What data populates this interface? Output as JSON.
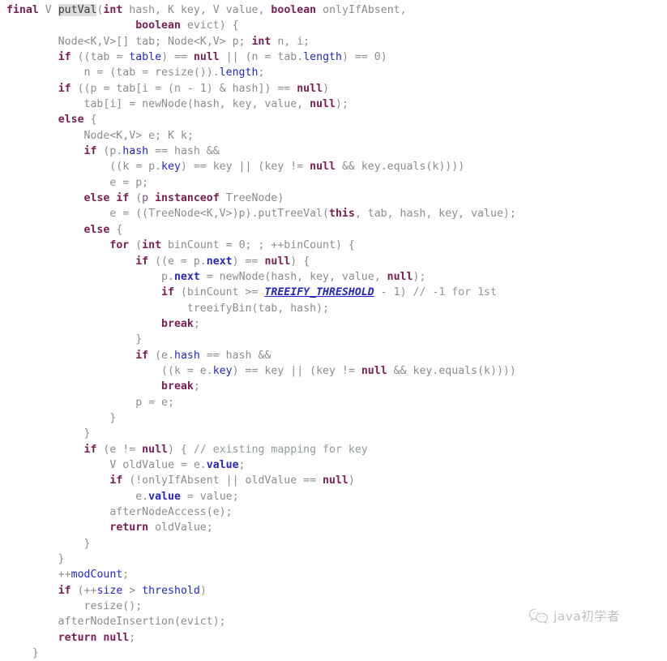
{
  "document": {
    "language": "java",
    "method_name": "putVal",
    "highlighted_identifier": "putVal",
    "background_color": "#ffffff",
    "line_count": 41
  },
  "theme": {
    "plain_text": "#8c8c8c",
    "keyword": "#7a1f54",
    "field": "#2626c4",
    "local_variable": "#7a5577",
    "constant": "#2626c4",
    "comment": "#8d9b95",
    "highlight_background": "#dcdcdc"
  },
  "watermark": {
    "icon": "wechat-chat-bubble-icon",
    "text": "java初学者"
  },
  "code": {
    "lines": [
      [
        [
          "final ",
          "kw"
        ],
        [
          "V ",
          "type"
        ],
        [
          "putVal",
          "hl"
        ],
        [
          "(",
          "plain"
        ],
        [
          "int ",
          "kw"
        ],
        [
          "hash",
          "plain"
        ],
        [
          ", ",
          "plain"
        ],
        [
          "K ",
          "type"
        ],
        [
          "key",
          "plain"
        ],
        [
          ", ",
          "plain"
        ],
        [
          "V ",
          "type"
        ],
        [
          "value",
          "plain"
        ],
        [
          ", ",
          "plain"
        ],
        [
          "boolean ",
          "kw"
        ],
        [
          "onlyIfAbsent",
          "plain"
        ],
        [
          ",",
          "plain"
        ]
      ],
      [
        [
          "                    ",
          "plain"
        ],
        [
          "boolean ",
          "kw"
        ],
        [
          "evict",
          "plain"
        ],
        [
          ") {",
          "plain"
        ]
      ],
      [
        [
          "        Node<K,V>[] tab; Node<K,V> p; ",
          "plain"
        ],
        [
          "int ",
          "kw"
        ],
        [
          "n, i;",
          "plain"
        ]
      ],
      [
        [
          "        ",
          "plain"
        ],
        [
          "if ",
          "kw"
        ],
        [
          "((tab = ",
          "plain"
        ],
        [
          "table",
          "field"
        ],
        [
          ") == ",
          "plain"
        ],
        [
          "null ",
          "kw"
        ],
        [
          "|| (n = tab.",
          "plain"
        ],
        [
          "length",
          "field"
        ],
        [
          ") == ",
          "plain"
        ],
        [
          "0",
          "num"
        ],
        [
          ")",
          "plain"
        ]
      ],
      [
        [
          "            n = (tab = resize()).",
          "plain"
        ],
        [
          "length",
          "field"
        ],
        [
          ";",
          "plain"
        ]
      ],
      [
        [
          "        ",
          "plain"
        ],
        [
          "if ",
          "kw"
        ],
        [
          "((p = tab[i = (n - ",
          "plain"
        ],
        [
          "1",
          "num"
        ],
        [
          ") & hash]) == ",
          "plain"
        ],
        [
          "null",
          "kw"
        ],
        [
          ")",
          "plain"
        ]
      ],
      [
        [
          "            tab[i] = newNode(hash, key, value, ",
          "plain"
        ],
        [
          "null",
          "kw"
        ],
        [
          ");",
          "plain"
        ]
      ],
      [
        [
          "        ",
          "plain"
        ],
        [
          "else ",
          "kw"
        ],
        [
          "{",
          "plain"
        ]
      ],
      [
        [
          "            Node<K,V> e; K k;",
          "plain"
        ]
      ],
      [
        [
          "            ",
          "plain"
        ],
        [
          "if ",
          "kw"
        ],
        [
          "(p.",
          "plain"
        ],
        [
          "hash ",
          "field"
        ],
        [
          "== hash &&",
          "plain"
        ]
      ],
      [
        [
          "                ((k = p.",
          "plain"
        ],
        [
          "key",
          "field"
        ],
        [
          ") == key || (key != ",
          "plain"
        ],
        [
          "null ",
          "kw"
        ],
        [
          "&& key.equals(k))))",
          "plain"
        ]
      ],
      [
        [
          "                e = p;",
          "plain"
        ]
      ],
      [
        [
          "            ",
          "plain"
        ],
        [
          "else if ",
          "kw"
        ],
        [
          "(",
          "plain"
        ],
        [
          "p ",
          "local"
        ],
        [
          "instanceof ",
          "kw"
        ],
        [
          "TreeNode)",
          "plain"
        ]
      ],
      [
        [
          "                e = ((TreeNode<K,V>)p).putTreeVal(",
          "plain"
        ],
        [
          "this",
          "kw"
        ],
        [
          ", tab, hash, key, value);",
          "plain"
        ]
      ],
      [
        [
          "            ",
          "plain"
        ],
        [
          "else ",
          "kw"
        ],
        [
          "{",
          "plain"
        ]
      ],
      [
        [
          "                ",
          "plain"
        ],
        [
          "for ",
          "kw"
        ],
        [
          "(",
          "plain"
        ],
        [
          "int ",
          "kw"
        ],
        [
          "binCount = ",
          "plain"
        ],
        [
          "0",
          "num"
        ],
        [
          "; ; ++binCount) {",
          "plain"
        ]
      ],
      [
        [
          "                    ",
          "plain"
        ],
        [
          "if ",
          "kw"
        ],
        [
          "((e = p.",
          "plain"
        ],
        [
          "next",
          "field-b"
        ],
        [
          ") == ",
          "plain"
        ],
        [
          "null",
          "kw"
        ],
        [
          ") {",
          "plain"
        ]
      ],
      [
        [
          "                        p.",
          "plain"
        ],
        [
          "next ",
          "field-b"
        ],
        [
          "= newNode(hash, key, value, ",
          "plain"
        ],
        [
          "null",
          "kw"
        ],
        [
          ");",
          "plain"
        ]
      ],
      [
        [
          "                        ",
          "plain"
        ],
        [
          "if ",
          "kw"
        ],
        [
          "(binCount >= ",
          "plain"
        ],
        [
          "TREEIFY_THRESHOLD",
          "const"
        ],
        [
          " - ",
          "plain"
        ],
        [
          "1",
          "num"
        ],
        [
          ") ",
          "plain"
        ],
        [
          "// -1 for 1st",
          "comment"
        ]
      ],
      [
        [
          "                            treeifyBin(tab, hash);",
          "plain"
        ]
      ],
      [
        [
          "                        ",
          "plain"
        ],
        [
          "break",
          "kw"
        ],
        [
          ";",
          "plain"
        ]
      ],
      [
        [
          "                    }",
          "plain"
        ]
      ],
      [
        [
          "                    ",
          "plain"
        ],
        [
          "if ",
          "kw"
        ],
        [
          "(e.",
          "plain"
        ],
        [
          "hash ",
          "field"
        ],
        [
          "== hash &&",
          "plain"
        ]
      ],
      [
        [
          "                        ((k = e.",
          "plain"
        ],
        [
          "key",
          "field"
        ],
        [
          ") == key || (key != ",
          "plain"
        ],
        [
          "null ",
          "kw"
        ],
        [
          "&& key.equals(k))))",
          "plain"
        ]
      ],
      [
        [
          "                        ",
          "plain"
        ],
        [
          "break",
          "kw"
        ],
        [
          ";",
          "plain"
        ]
      ],
      [
        [
          "                    p = e;",
          "plain"
        ]
      ],
      [
        [
          "                }",
          "plain"
        ]
      ],
      [
        [
          "            }",
          "plain"
        ]
      ],
      [
        [
          "            ",
          "plain"
        ],
        [
          "if ",
          "kw"
        ],
        [
          "(e != ",
          "plain"
        ],
        [
          "null",
          "kw"
        ],
        [
          ") { ",
          "plain"
        ],
        [
          "// existing mapping for key",
          "comment"
        ]
      ],
      [
        [
          "                V oldValue = e.",
          "plain"
        ],
        [
          "value",
          "field-b"
        ],
        [
          ";",
          "plain"
        ]
      ],
      [
        [
          "                ",
          "plain"
        ],
        [
          "if ",
          "kw"
        ],
        [
          "(!onlyIfAbsent || oldValue == ",
          "plain"
        ],
        [
          "null",
          "kw"
        ],
        [
          ")",
          "plain"
        ]
      ],
      [
        [
          "                    e.",
          "plain"
        ],
        [
          "value ",
          "field-b"
        ],
        [
          "= value;",
          "plain"
        ]
      ],
      [
        [
          "                afterNodeAccess(e);",
          "plain"
        ]
      ],
      [
        [
          "                ",
          "plain"
        ],
        [
          "return ",
          "kw"
        ],
        [
          "oldValue;",
          "plain"
        ]
      ],
      [
        [
          "            }",
          "plain"
        ]
      ],
      [
        [
          "        }",
          "plain"
        ]
      ],
      [
        [
          "        ++",
          "plain"
        ],
        [
          "modCount",
          "field"
        ],
        [
          ";",
          "plain"
        ]
      ],
      [
        [
          "        ",
          "plain"
        ],
        [
          "if ",
          "kw"
        ],
        [
          "(++",
          "plain"
        ],
        [
          "size ",
          "field"
        ],
        [
          "> ",
          "plain"
        ],
        [
          "threshold",
          "field"
        ],
        [
          ")",
          "plain"
        ]
      ],
      [
        [
          "            resize();",
          "plain"
        ]
      ],
      [
        [
          "        afterNodeInsertion(evict);",
          "plain"
        ]
      ],
      [
        [
          "        ",
          "plain"
        ],
        [
          "return ",
          "kw"
        ],
        [
          "null",
          "kw"
        ],
        [
          ";",
          "plain"
        ]
      ],
      [
        [
          "    }",
          "plain"
        ]
      ]
    ]
  }
}
